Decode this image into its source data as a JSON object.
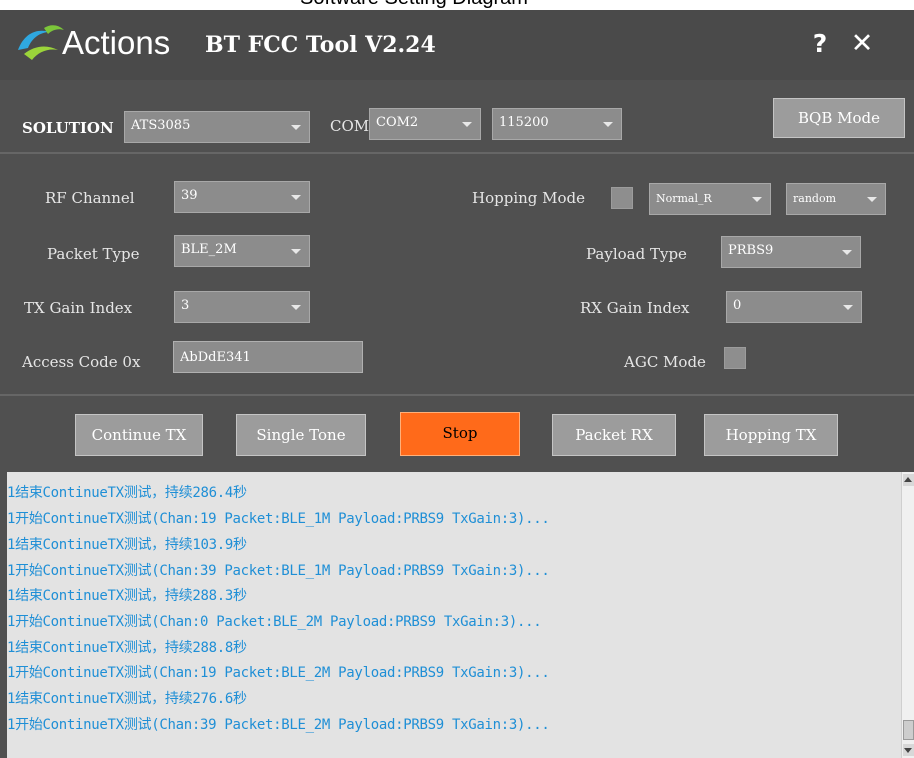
{
  "caption": "Software Setting Diagram",
  "window": {
    "app_name": "Actions",
    "subtitle": "BT FCC Tool V2.24",
    "help_label": "?",
    "close_label": "✕"
  },
  "config": {
    "solution_label": "SOLUTION",
    "solution_value": "ATS3085",
    "com_label": "COM",
    "com_value": "COM2",
    "baud_value": "115200",
    "bqb_button": "BQB Mode"
  },
  "settings": {
    "rf_channel_label": "RF Channel",
    "rf_channel_value": "39",
    "hopping_mode_label": "Hopping Mode",
    "hopping_type_value": "Normal_R",
    "hopping_order_value": "random",
    "packet_type_label": "Packet Type",
    "packet_type_value": "BLE_2M",
    "payload_type_label": "Payload Type",
    "payload_type_value": "PRBS9",
    "tx_gain_label": "TX Gain Index",
    "tx_gain_value": "3",
    "rx_gain_label": "RX Gain Index",
    "rx_gain_value": "0",
    "access_code_label": "Access Code 0x",
    "access_code_value": "AbDdE341",
    "agc_mode_label": "AGC Mode"
  },
  "actions": {
    "continue_tx": "Continue TX",
    "single_tone": "Single Tone",
    "stop": "Stop",
    "packet_rx": "Packet RX",
    "hopping_tx": "Hopping TX"
  },
  "colors": {
    "window_bg": "#505050",
    "stop_button": "#ff6a1a",
    "log_text": "#1f8fd6",
    "log_bg": "#e3e3e3"
  },
  "log": [
    "1结束ContinueTX测试，持续286.4秒",
    "1开始ContinueTX测试(Chan:19 Packet:BLE_1M Payload:PRBS9 TxGain:3)...",
    "1结束ContinueTX测试，持续103.9秒",
    "1开始ContinueTX测试(Chan:39 Packet:BLE_1M Payload:PRBS9 TxGain:3)...",
    "1结束ContinueTX测试，持续288.3秒",
    "1开始ContinueTX测试(Chan:0 Packet:BLE_2M Payload:PRBS9 TxGain:3)...",
    "1结束ContinueTX测试，持续288.8秒",
    "1开始ContinueTX测试(Chan:19 Packet:BLE_2M Payload:PRBS9 TxGain:3)...",
    "1结束ContinueTX测试，持续276.6秒",
    "1开始ContinueTX测试(Chan:39 Packet:BLE_2M Payload:PRBS9 TxGain:3)..."
  ]
}
